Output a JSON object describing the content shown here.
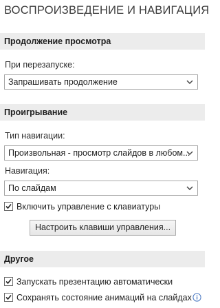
{
  "panel": {
    "title": "ВОСПРОИЗВЕДЕНИЕ И НАВИГАЦИЯ"
  },
  "continue_viewing": {
    "header": "Продолжение просмотра",
    "restart_label": "При перезапуске:",
    "restart_value": "Запрашивать продолжение"
  },
  "playback": {
    "header": "Проигрывание",
    "nav_type_label": "Тип навигации:",
    "nav_type_value": "Произвольная - просмотр слайдов в любом...",
    "navigation_label": "Навигация:",
    "navigation_value": "По слайдам",
    "keyboard_control": {
      "label": "Включить управление с клавиатуры",
      "checked": true
    },
    "configure_keys_button": "Настроить клавиши управления..."
  },
  "other": {
    "header": "Другое",
    "autostart": {
      "label": "Запускать презентацию автоматически",
      "checked": true
    },
    "save_animation": {
      "label": "Сохранять состояние анимаций на слайдах",
      "checked": true
    }
  },
  "icons": {
    "dropdown": "chevron-down-icon",
    "checkmark": "checkmark-icon",
    "info": "info-icon"
  },
  "colors": {
    "section_bg": "#ececec",
    "info_icon": "#4a78c2"
  }
}
